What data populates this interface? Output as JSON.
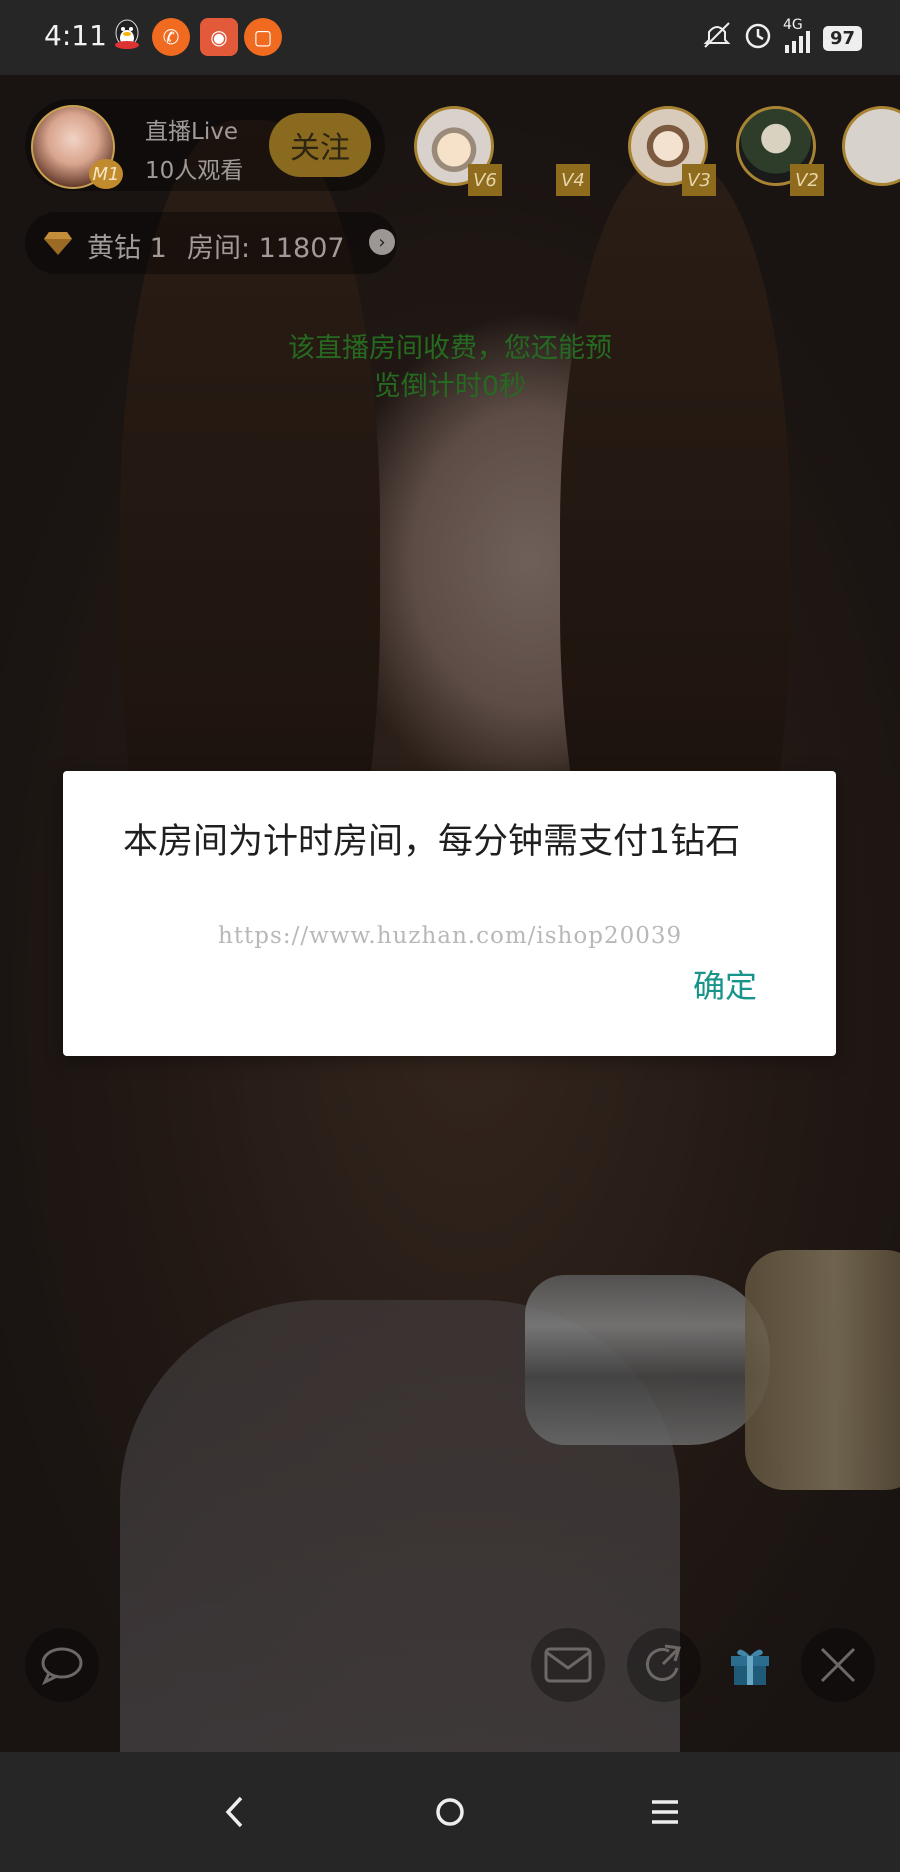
{
  "status_bar": {
    "time": "4:11",
    "network": "4G",
    "battery": "97",
    "icons": [
      "qq-icon",
      "phone-icon",
      "app-icon",
      "screen-record-icon",
      "mute-icon",
      "alarm-icon",
      "signal-icon",
      "battery-icon"
    ]
  },
  "anchor": {
    "name": "直播Live",
    "viewers": "10人观看",
    "level_badge": "M1",
    "follow_label": "关注"
  },
  "audience": [
    {
      "badge": "V6"
    },
    {
      "badge": "V4"
    },
    {
      "badge": "V3"
    },
    {
      "badge": "V2"
    },
    {
      "badge": ""
    }
  ],
  "room": {
    "level": "黄钻 1",
    "room_no": "房间: 11807"
  },
  "notice": {
    "line1": "该直播房间收费，您还能预",
    "line2": "览倒计时0秒"
  },
  "dialog": {
    "message": "本房间为计时房间，每分钟需支付1钻石",
    "watermark": "https://www.huzhan.com/ishop20039",
    "confirm_label": "确定"
  },
  "colors": {
    "accent_teal": "#18948a",
    "notice_green": "#256a20",
    "gold": "#a88432"
  },
  "bottom_controls": [
    "chat-icon",
    "message-icon",
    "share-icon",
    "gift-icon",
    "close-icon"
  ],
  "nav": [
    "back-icon",
    "home-icon",
    "menu-icon"
  ]
}
